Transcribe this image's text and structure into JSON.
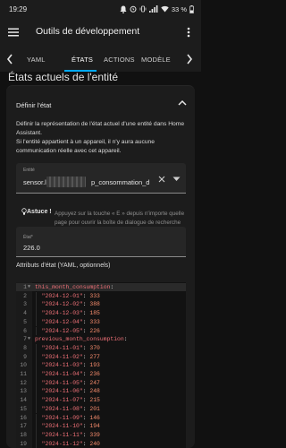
{
  "status_bar": {
    "time": "19:29",
    "battery": "33 %"
  },
  "app_bar": {
    "title": "Outils de développement",
    "tabs": [
      "YAML",
      "ÉTATS",
      "ACTIONS",
      "MODÈLE"
    ],
    "active_tab": "ÉTATS"
  },
  "page": {
    "heading": "États actuels de l'entité"
  },
  "card": {
    "header": "Définir l'état",
    "description": [
      "Définir la représentation de l'état actuel d'une entité dans Home Assistant.",
      "Si l'entité appartient à un appareil, il n'y aura aucune communication réelle avec cet appareil."
    ],
    "entity": {
      "label": "Entité",
      "value_prefix": "sensor.l",
      "value_suffix": "p_consommation_d"
    },
    "tip": {
      "label": "Astuce !",
      "text": "Appuyez sur la touche « E » depuis n'importe quelle page pour ouvrir la boîte de dialogue de recherche d'entité"
    },
    "state": {
      "label": "État*",
      "value": "226.0"
    },
    "attributes_label": "Attributs d'état (YAML, optionnels)",
    "code_lines": [
      {
        "num": "1",
        "fold": "▼",
        "key": "this_month_consumption",
        "kind": "head"
      },
      {
        "num": "2",
        "date": "2024-12-01",
        "value": "333"
      },
      {
        "num": "3",
        "date": "2024-12-02",
        "value": "388"
      },
      {
        "num": "4",
        "date": "2024-12-03",
        "value": "185"
      },
      {
        "num": "5",
        "date": "2024-12-04",
        "value": "333"
      },
      {
        "num": "6",
        "date": "2024-12-05",
        "value": "226"
      },
      {
        "num": "7",
        "fold": "▼",
        "key": "previous_month_consumption",
        "kind": "head"
      },
      {
        "num": "8",
        "date": "2024-11-01",
        "value": "370"
      },
      {
        "num": "9",
        "date": "2024-11-02",
        "value": "277"
      },
      {
        "num": "10",
        "date": "2024-11-03",
        "value": "193"
      },
      {
        "num": "11",
        "date": "2024-11-04",
        "value": "236"
      },
      {
        "num": "12",
        "date": "2024-11-05",
        "value": "247"
      },
      {
        "num": "13",
        "date": "2024-11-06",
        "value": "248"
      },
      {
        "num": "14",
        "date": "2024-11-07",
        "value": "215"
      },
      {
        "num": "15",
        "date": "2024-11-08",
        "value": "201"
      },
      {
        "num": "16",
        "date": "2024-11-09",
        "value": "146"
      },
      {
        "num": "17",
        "date": "2024-11-10",
        "value": "194"
      },
      {
        "num": "18",
        "date": "2024-11-11",
        "value": "339"
      },
      {
        "num": "19",
        "date": "2024-11-12",
        "value": "240"
      }
    ]
  },
  "colors": {
    "accent": "#03a9f4",
    "background": "#111111",
    "card": "#1c1c1c",
    "yaml_key": "#f07178",
    "yaml_number": "#f78c6c"
  }
}
